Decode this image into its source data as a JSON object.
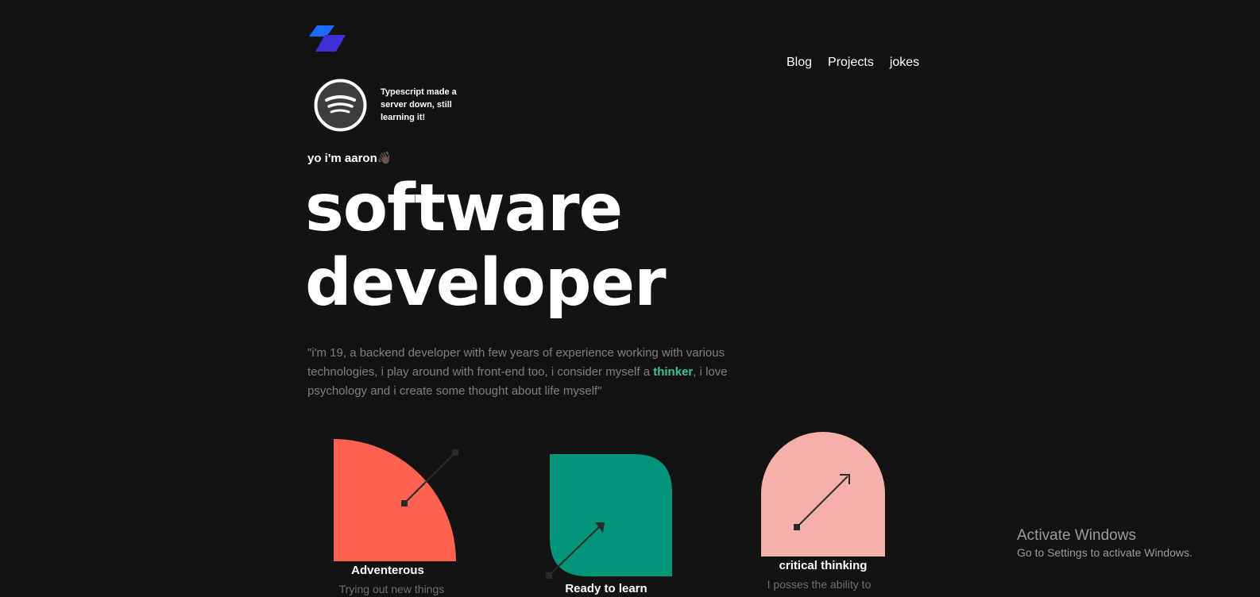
{
  "nav": {
    "links": [
      "Blog",
      "Projects",
      "jokes"
    ]
  },
  "now_playing": {
    "text": "Typescript made a server down, still learning it!"
  },
  "hero": {
    "greeting": "yo i'm aaron👋🏿",
    "headline_line1": "software",
    "headline_line2": "developer",
    "bio_before": "\"i'm 19, a backend developer with few years of experience working with various technologies, i play around with front-end too, i consider myself a ",
    "bio_highlight": "thinker",
    "bio_after": ", i love psychology and i create some thought about life myself\""
  },
  "traits": [
    {
      "title": "Adventerous",
      "desc": "Trying out new things",
      "color": "#ff6250"
    },
    {
      "title": "Ready to learn",
      "desc": "",
      "color": "#009478"
    },
    {
      "title": "critical thinking",
      "desc": "I posses the ability to",
      "color": "#f4b0a9"
    }
  ],
  "colors": {
    "background": "#131313",
    "accent_green": "#3dc58a",
    "logo_blue": "#1d6cff",
    "logo_indigo": "#3b2fd6"
  },
  "watermark": {
    "title": "Activate Windows",
    "subtitle": "Go to Settings to activate Windows."
  }
}
